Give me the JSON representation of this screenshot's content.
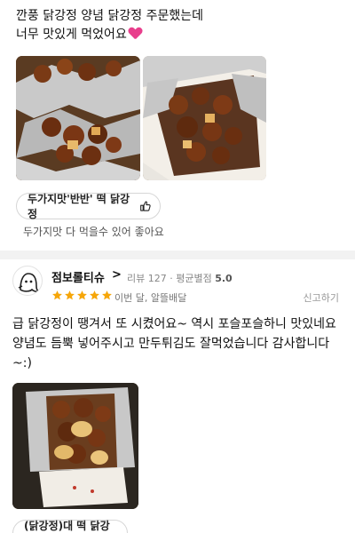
{
  "review1": {
    "text_line1": "깐풍 닭강정 양념 닭강정 주문했는데",
    "text_line2": "너무 맛있게 먹었어요",
    "heart_icon": "heart-icon",
    "photos": [
      "food-photo",
      "food-photo"
    ],
    "menu_chip_label": "두가지맛'반반' 떡 닭강정",
    "menu_comment": "두가지맛 다 먹을수 있어 좋아요"
  },
  "review2": {
    "username": "점보롤티슈",
    "chevron": ">",
    "review_count_label": "리뷰 127",
    "meta_separator": "·",
    "rating_avg_label": "평균별점",
    "rating_avg_value": "5.0",
    "rating": 5,
    "date": "이번 달, 알뜰배달",
    "report_label": "신고하기",
    "text": "급 닭강정이 땡겨서 또 시켰어요~  역시 포슬포슬하니 맛있네요 양념도 듬뿍 넣어주시고 만두튀김도 잘먹었습니다 감사합니다~:)",
    "photos": [
      "food-photo"
    ],
    "menu_chip_label": "(닭강정)대 떡 닭강정"
  },
  "colors": {
    "star": "#f6a609",
    "heart": "#e83e8c",
    "divider": "#f2f2f2"
  }
}
